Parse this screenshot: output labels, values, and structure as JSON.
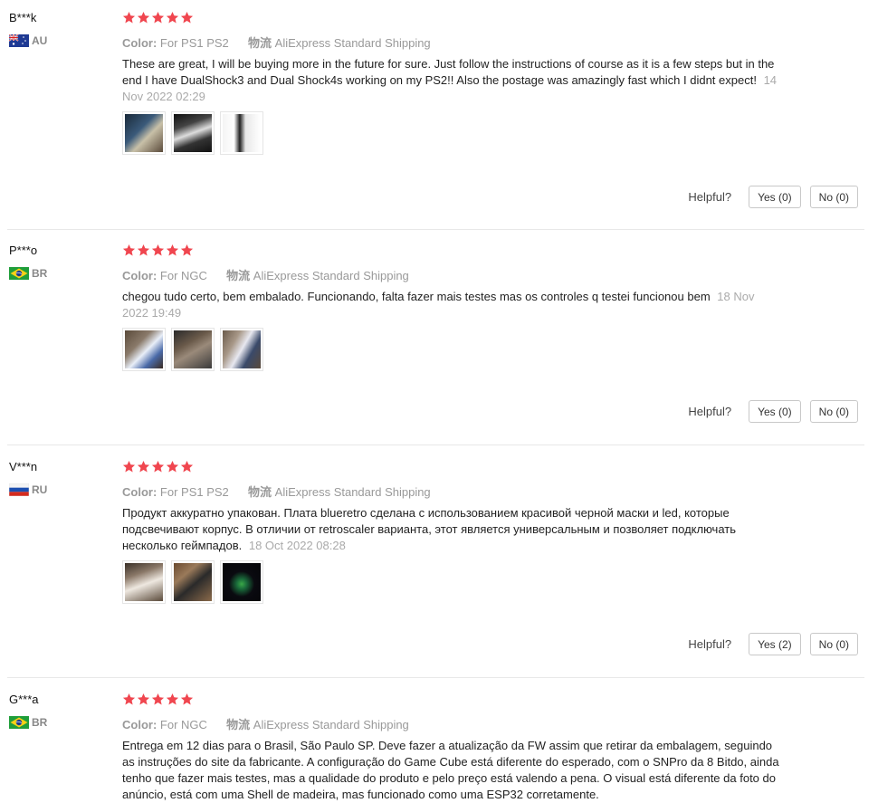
{
  "labels": {
    "color": "Color:",
    "shipping": "物流",
    "helpful": "Helpful?"
  },
  "colors": {
    "star": "#f0464f",
    "meta_text": "#999999",
    "date_text": "#aaaaaa"
  },
  "reviews": [
    {
      "user": "B***k",
      "country": "AU",
      "flag_icon": "flag-australia-icon",
      "rating": 5,
      "color_value": "For PS1 PS2",
      "shipping_value": "AliExpress Standard Shipping",
      "text": "These are great, I will be buying more in the future for sure. Just follow the instructions of course as it is a few steps but in the end I have DualShock3 and Dual Shock4s working on my PS2!! Also the postage was amazingly fast which I didnt expect!",
      "date": "14 Nov 2022 02:29",
      "images": [
        "review-photo",
        "review-photo",
        "review-photo"
      ],
      "yes": "Yes (0)",
      "no": "No (0)"
    },
    {
      "user": "P***o",
      "country": "BR",
      "flag_icon": "flag-brazil-icon",
      "rating": 5,
      "color_value": "For NGC",
      "shipping_value": "AliExpress Standard Shipping",
      "text": "chegou tudo certo, bem embalado. Funcionando, falta fazer mais testes mas os controles q testei funcionou bem",
      "date": "18 Nov 2022 19:49",
      "images": [
        "review-photo",
        "review-photo",
        "review-photo"
      ],
      "yes": "Yes (0)",
      "no": "No (0)"
    },
    {
      "user": "V***n",
      "country": "RU",
      "flag_icon": "flag-russia-icon",
      "rating": 5,
      "color_value": "For PS1 PS2",
      "shipping_value": "AliExpress Standard Shipping",
      "text": "Продукт аккуратно упакован. Плата blueretro сделана с использованием красивой черной маски и led, которые подсвечивают корпус. В отличии от retroscaler варианта, этот является универсальным и позволяет подключать несколько геймпадов.",
      "date": "18 Oct 2022 08:28",
      "images": [
        "review-photo",
        "review-photo",
        "review-photo"
      ],
      "yes": "Yes (2)",
      "no": "No (0)"
    },
    {
      "user": "G***a",
      "country": "BR",
      "flag_icon": "flag-brazil-icon",
      "rating": 5,
      "color_value": "For NGC",
      "shipping_value": "AliExpress Standard Shipping",
      "text": "Entrega em 12 dias para o Brasil, São Paulo SP. Deve fazer a atualização da FW assim que retirar da embalagem, seguindo as instruções do site da fabricante. A configuração do Game Cube está diferente do esperado, com o SNPro da 8 Bitdo, ainda tenho que fazer mais testes, mas a qualidade do produto e pelo preço está valendo a pena. O visual está diferente da foto do anúncio, está com uma Shell de madeira, mas funcionado como uma ESP32 corretamente."
    }
  ]
}
